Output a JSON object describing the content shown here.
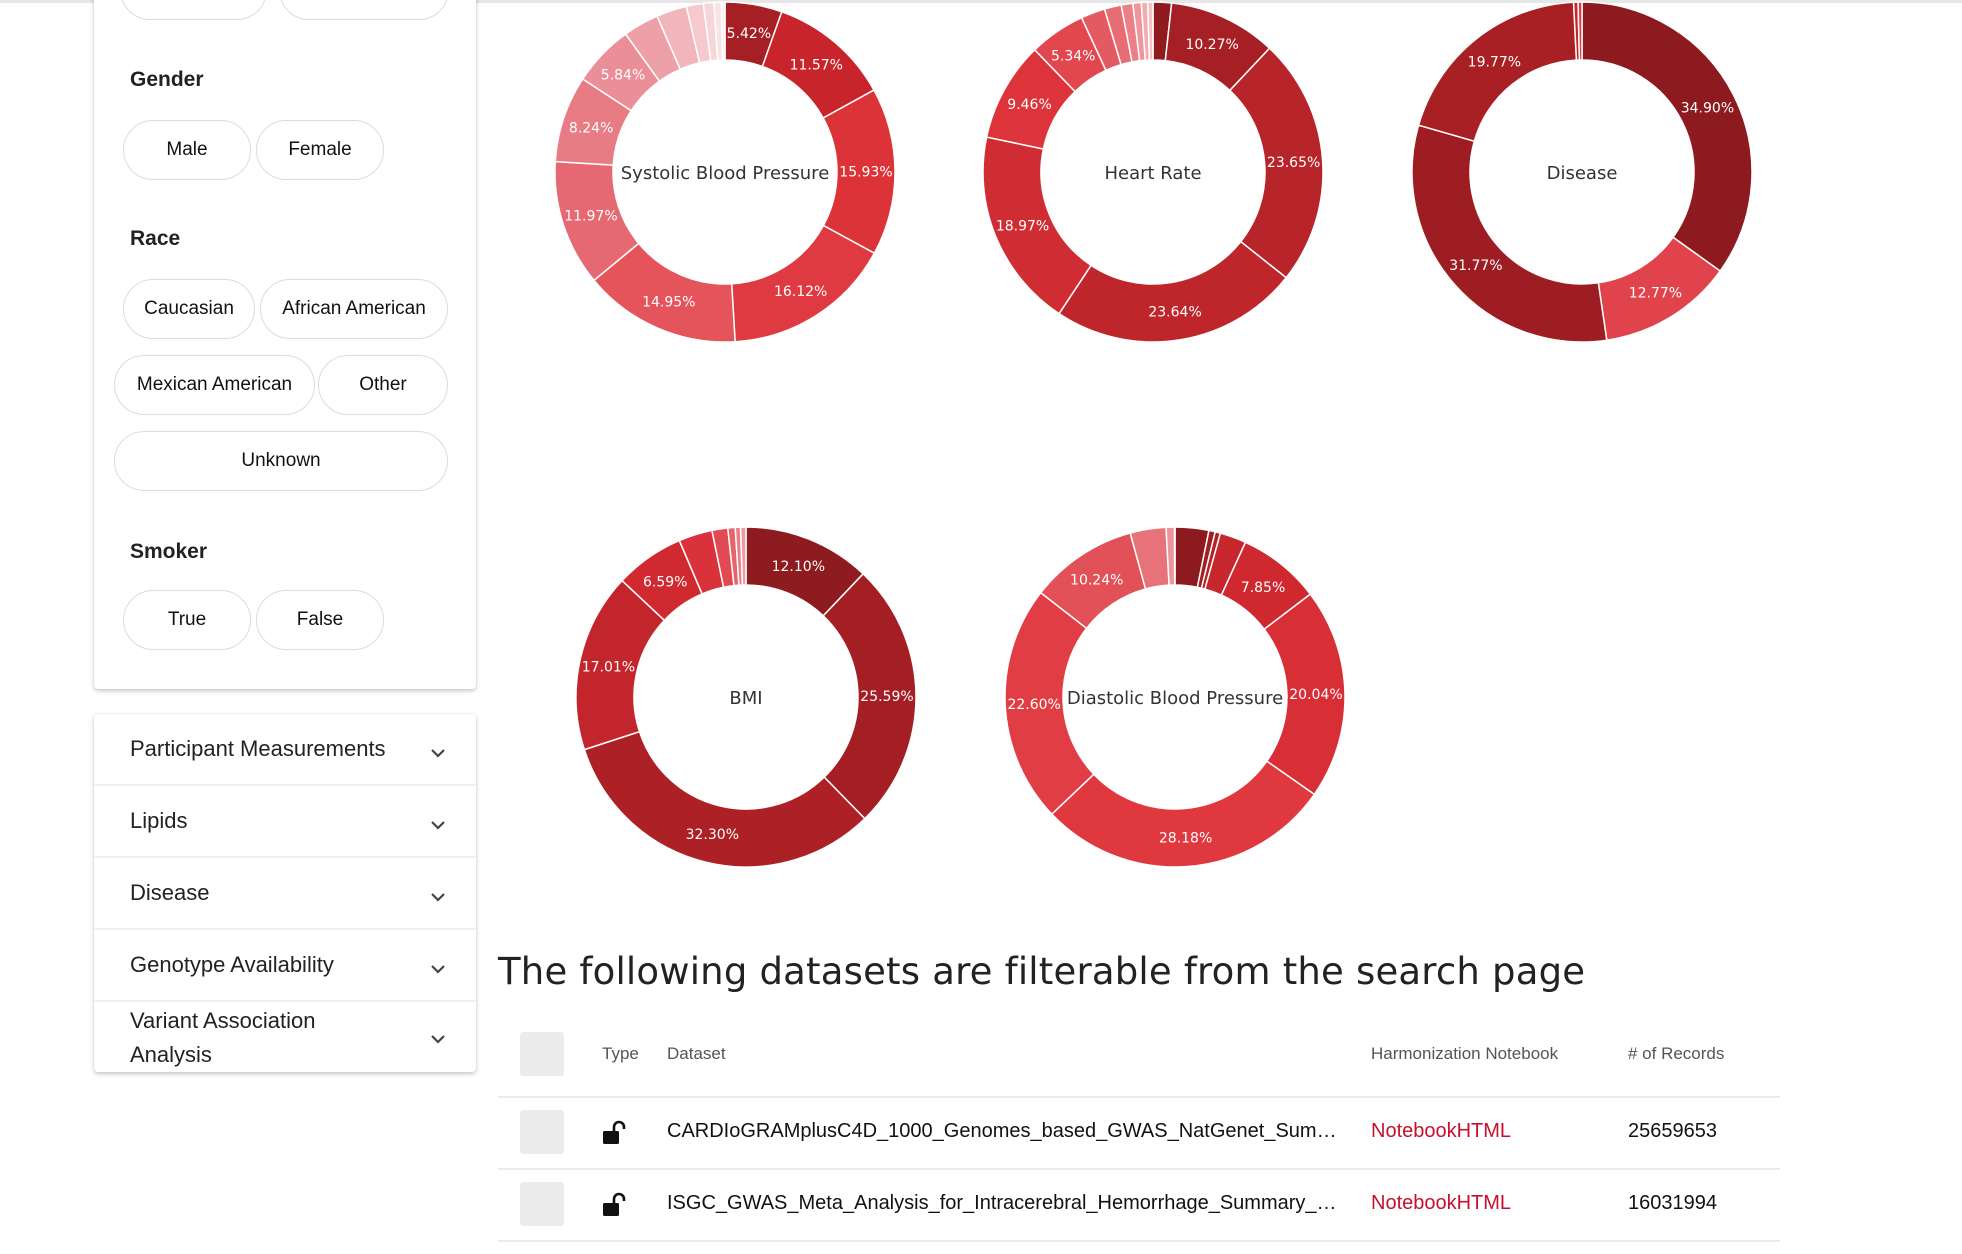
{
  "filters": {
    "top_ghost_pills": [
      "",
      ""
    ],
    "gender": {
      "label": "Gender",
      "options": [
        "Male",
        "Female"
      ]
    },
    "race": {
      "label": "Race",
      "options": [
        "Caucasian",
        "African American",
        "Mexican American",
        "Other",
        "Unknown"
      ]
    },
    "smoker": {
      "label": "Smoker",
      "options": [
        "True",
        "False"
      ]
    }
  },
  "accordion": [
    {
      "label": "Participant Measurements",
      "icon": "chevron-down-icon"
    },
    {
      "label": "Lipids",
      "icon": "chevron-down-icon"
    },
    {
      "label": "Disease",
      "icon": "chevron-down-icon"
    },
    {
      "label": "Genotype Availability",
      "icon": "chevron-down-icon"
    },
    {
      "label": "Variant Association Analysis",
      "icon": "chevron-down-icon"
    }
  ],
  "chart_data": [
    {
      "type": "pie",
      "title": "Systolic Blood Pressure",
      "values": [
        5.42,
        11.57,
        15.93,
        16.12,
        14.95,
        11.97,
        8.24,
        5.84,
        3.4,
        2.9,
        1.6,
        1.0,
        0.7,
        0.34
      ],
      "labels": [
        "5.42%",
        "11.57%",
        "15.93%",
        "16.12%",
        "14.95%",
        "11.97%",
        "8.24%",
        "5.84%",
        "",
        "",
        "",
        "",
        "",
        ""
      ],
      "colors": [
        "#a51f25",
        "#c8242b",
        "#dc3339",
        "#df3a41",
        "#e5535b",
        "#e66872",
        "#e87c85",
        "#ea8e97",
        "#eda0a7",
        "#f1b6bc",
        "#f5c9cd",
        "#f7d6d9",
        "#fae3e5",
        "#fcecee"
      ]
    },
    {
      "type": "pie",
      "title": "Heart Rate",
      "values": [
        1.75,
        10.27,
        23.65,
        23.64,
        18.97,
        9.46,
        5.34,
        2.3,
        1.6,
        1.1,
        0.8,
        0.6,
        0.5
      ],
      "labels": [
        "",
        "10.27%",
        "23.65%",
        "23.64%",
        "18.97%",
        "9.46%",
        "5.34%",
        "",
        "",
        "",
        "",
        "",
        ""
      ],
      "colors": [
        "#8f1b1f",
        "#a51f25",
        "#b7242a",
        "#bf262c",
        "#cf2c33",
        "#dd343b",
        "#e2464e",
        "#e45a62",
        "#e86c74",
        "#eb8088",
        "#ef959c",
        "#f3abb1",
        "#f7c2c6"
      ]
    },
    {
      "type": "pie",
      "title": "Disease",
      "values": [
        34.9,
        12.77,
        31.77,
        19.77,
        0.42,
        0.37
      ],
      "labels": [
        "34.90%",
        "12.77%",
        "31.77%",
        "19.77%",
        "",
        ""
      ],
      "colors": [
        "#8c1a1e",
        "#e0434b",
        "#9e1d22",
        "#a81f24",
        "#c4252b",
        "#dd3a41"
      ]
    },
    {
      "type": "pie",
      "title": "BMI",
      "values": [
        12.1,
        25.59,
        32.3,
        17.01,
        6.59,
        3.2,
        1.5,
        0.7,
        0.5,
        0.51
      ],
      "labels": [
        "12.10%",
        "25.59%",
        "32.30%",
        "17.01%",
        "6.59%",
        "",
        "",
        "",
        "",
        ""
      ],
      "colors": [
        "#8e1b1f",
        "#a31f24",
        "#ad2026",
        "#c2252b",
        "#d0292f",
        "#d9323a",
        "#e14a52",
        "#e6646c",
        "#ea7d85",
        "#ee9aa1"
      ]
    },
    {
      "type": "pie",
      "title": "Diastolic Blood Pressure",
      "values": [
        3.2,
        0.6,
        0.5,
        2.5,
        7.85,
        20.04,
        28.18,
        22.6,
        10.24,
        3.4,
        0.8,
        0.04
      ],
      "labels": [
        "",
        "",
        "",
        "",
        "7.85%",
        "20.04%",
        "28.18%",
        "22.60%",
        "10.24%",
        "",
        "",
        ""
      ],
      "colors": [
        "#8c1a1e",
        "#a21e23",
        "#b42228",
        "#c6262c",
        "#cf282e",
        "#d82e35",
        "#df383f",
        "#e03d44",
        "#e25058",
        "#e7727a",
        "#ec959c",
        "#f3c0c4"
      ]
    }
  ],
  "datasets": {
    "title": "The following datasets are filterable from the search page",
    "columns": [
      "Type",
      "Dataset",
      "Harmonization Notebook",
      "# of Records"
    ],
    "rows": [
      {
        "type_icon": "unlock-icon",
        "dataset": "CARDIoGRAMplusC4D_1000_Genomes_based_GWAS_NatGenet_Sum…",
        "notebook": "NotebookHTML",
        "records": "25659653"
      },
      {
        "type_icon": "unlock-icon",
        "dataset": "ISGC_GWAS_Meta_Analysis_for_Intracerebral_Hemorrhage_Summary_…",
        "notebook": "NotebookHTML",
        "records": "16031994"
      }
    ],
    "link_color": "#c8102e"
  }
}
